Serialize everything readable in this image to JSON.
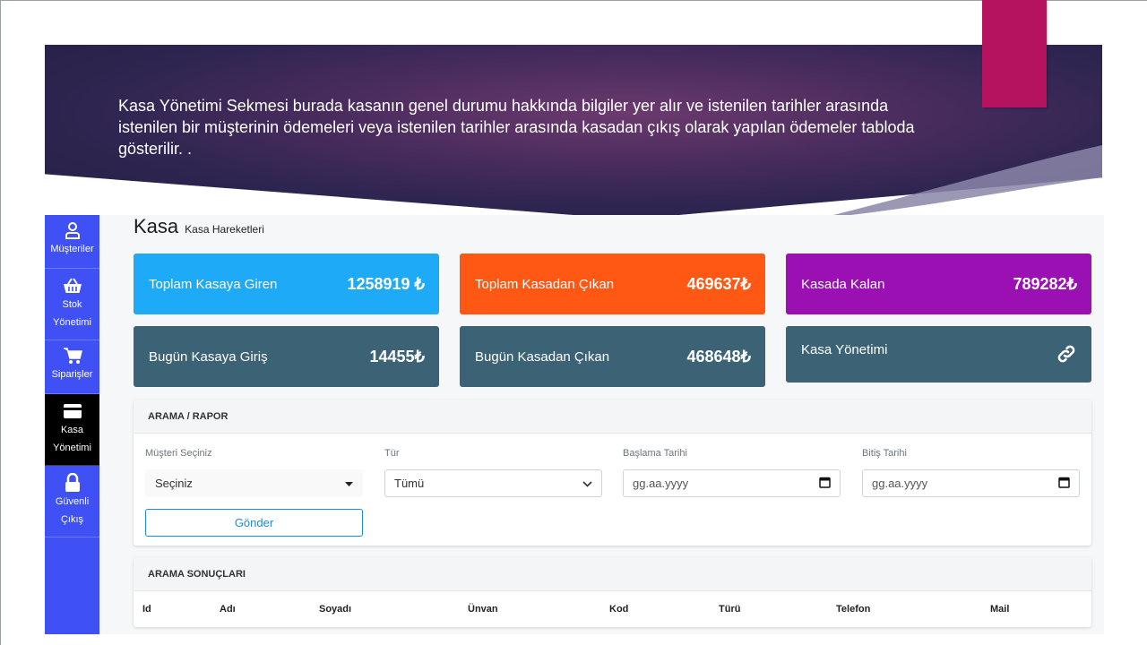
{
  "slide": {
    "description": "Kasa Yönetimi Sekmesi burada kasanın genel durumu hakkında bilgiler yer alır ve istenilen tarihler arasında istenilen bir müşterinin ödemeleri veya istenilen tarihler arasında  kasadan çıkış olarak yapılan ödemeler tabloda gösterilir. .",
    "accent_color": "#b5135f"
  },
  "sidebar": {
    "items": [
      {
        "label": "Müşteriler",
        "icon": "user-icon"
      },
      {
        "label": "Stok Yönetimi",
        "icon": "basket-icon"
      },
      {
        "label": "Siparişler",
        "icon": "cart-icon"
      },
      {
        "label": "Kasa Yönetimi",
        "icon": "wallet-icon",
        "active": true
      },
      {
        "label": "Güvenli Çıkış",
        "icon": "lock-icon"
      }
    ]
  },
  "page": {
    "title": "Kasa",
    "subtitle": "Kasa Hareketleri"
  },
  "cards": [
    {
      "label": "Toplam Kasaya Giren",
      "value": "1258919 ₺",
      "color": "#1eaaf7"
    },
    {
      "label": "Toplam Kasadan Çıkan",
      "value": "469637₺",
      "color": "#ff5714"
    },
    {
      "label": "Kasada Kalan",
      "value": "789282₺",
      "color": "#9a10b3"
    },
    {
      "label": "Bugün Kasaya Giriş",
      "value": "14455₺",
      "color": "#3b6375"
    },
    {
      "label": "Bugün Kasadan Çıkan",
      "value": "468648₺",
      "color": "#3b6375"
    },
    {
      "label": "Kasa Yönetimi",
      "icon": "link-icon",
      "color": "#3b6375"
    }
  ],
  "search": {
    "header": "ARAMA / RAPOR",
    "fields": [
      {
        "label": "Müşteri Seçiniz",
        "value": "Seçiniz"
      },
      {
        "label": "Tür",
        "value": "Tümü"
      },
      {
        "label": "Başlama Tarihi",
        "placeholder": "gg.aa.yyyy"
      },
      {
        "label": "Bitiş Tarihi",
        "placeholder": "gg.aa.yyyy"
      }
    ],
    "submit_label": "Gönder"
  },
  "results": {
    "header": "ARAMA SONUÇLARI",
    "columns": [
      "Id",
      "Adı",
      "Soyadı",
      "Ünvan",
      "Kod",
      "Türü",
      "Telefon",
      "Mail"
    ]
  }
}
